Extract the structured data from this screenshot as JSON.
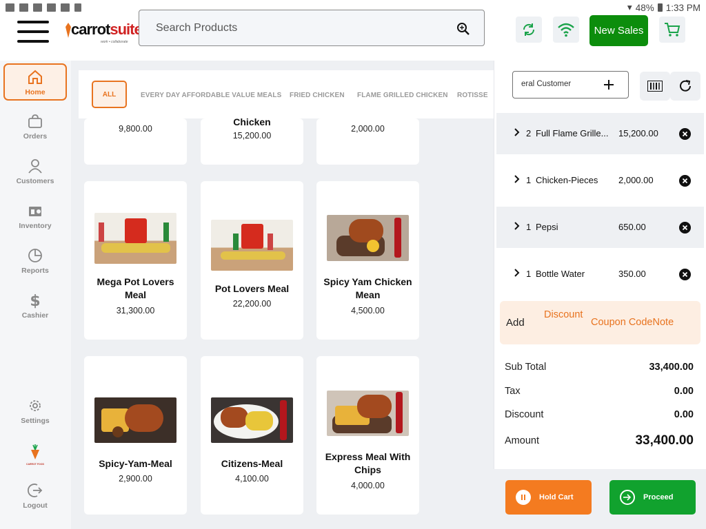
{
  "status_bar": {
    "battery": "48%",
    "time": "1:33 PM"
  },
  "header": {
    "logo_a": "carrot",
    "logo_b": "suite",
    "logo_tag": "work • collaborate",
    "search_placeholder": "Search Products",
    "new_sales_label": "New Sales"
  },
  "sidebar": {
    "items": [
      {
        "label": "Home",
        "icon": "home-icon",
        "active": true
      },
      {
        "label": "Orders",
        "icon": "bag-icon"
      },
      {
        "label": "Customers",
        "icon": "person-icon"
      },
      {
        "label": "Inventory",
        "icon": "inventory-icon"
      },
      {
        "label": "Reports",
        "icon": "pie-chart-icon"
      },
      {
        "label": "Cashier",
        "icon": "dollar-icon"
      },
      {
        "label": "Settings",
        "icon": "gear-icon"
      },
      {
        "label": "Logout",
        "icon": "logout-icon"
      }
    ],
    "brand_caption": "CARROT FOOD"
  },
  "categories": [
    "ALL",
    "EVERY DAY AFFORDABLE VALUE MEALS",
    "FRIED CHICKEN",
    "FLAME GRILLED CHICKEN",
    "ROTISSE"
  ],
  "products": [
    {
      "name": "",
      "price": "9,800.00"
    },
    {
      "name": "Chicken",
      "price": "15,200.00"
    },
    {
      "name": "",
      "price": "2,000.00"
    },
    {
      "name_lines": [
        "Mega Pot Lovers",
        "Meal"
      ],
      "price": "31,300.00"
    },
    {
      "name_lines": [
        "Pot Lovers Meal"
      ],
      "price": "22,200.00"
    },
    {
      "name_lines": [
        "Spicy Yam Chicken",
        "Mean"
      ],
      "price": "4,500.00"
    },
    {
      "name_lines": [
        "Spicy-Yam-Meal"
      ],
      "price": "2,900.00"
    },
    {
      "name_lines": [
        "Citizens-Meal"
      ],
      "price": "4,100.00"
    },
    {
      "name_lines": [
        "Express Meal With",
        "Chips"
      ],
      "price": "4,000.00"
    }
  ],
  "cart": {
    "customer": "eral Customer",
    "items": [
      {
        "qty": "2",
        "name": "Full Flame Grille...",
        "amount": "15,200.00"
      },
      {
        "qty": "1",
        "name": "Chicken-Pieces",
        "amount": "2,000.00"
      },
      {
        "qty": "1",
        "name": "Pepsi",
        "amount": "650.00"
      },
      {
        "qty": "1",
        "name": "Bottle Water",
        "amount": "350.00"
      }
    ],
    "add_label": "Add",
    "discount_label": "Discount",
    "coupon_label": "Coupon Code",
    "note_label": "Note",
    "subtotal_label": "Sub Total",
    "subtotal": "33,400.00",
    "tax_label": "Tax",
    "tax": "0.00",
    "discount_row_label": "Discount",
    "discount": "0.00",
    "amount_label": "Amount",
    "amount": "33,400.00",
    "hold_label": "Hold Cart",
    "proceed_label": "Proceed"
  },
  "colors": {
    "accent": "#e8731f",
    "green": "#0c8d0c"
  }
}
